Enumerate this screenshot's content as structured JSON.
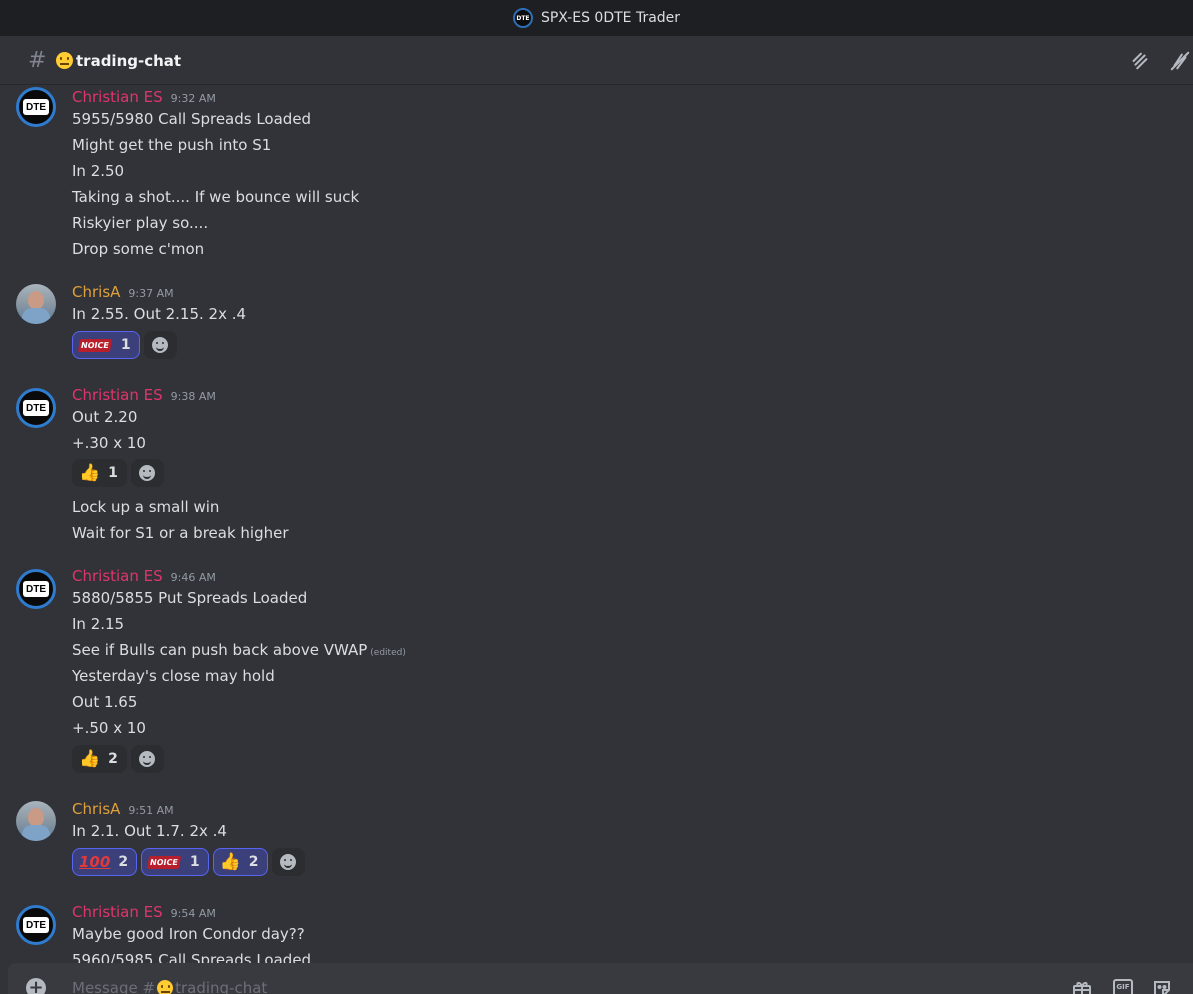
{
  "window": {
    "title": "SPX-ES 0DTE Trader"
  },
  "channel": {
    "hash": "#",
    "name": "trading-chat"
  },
  "messages": [
    {
      "author": "Christian ES",
      "time": "9:32 AM",
      "lines": [
        "5955/5980 Call Spreads Loaded",
        "Might get the push into S1",
        "In 2.50",
        "Taking a shot.... If we bounce will suck",
        "Riskyier play so....",
        "Drop some c'mon"
      ]
    },
    {
      "author": "ChrisA",
      "time": "9:37 AM",
      "lines": [
        "In 2.55. Out 2.15.  2x .4"
      ],
      "reactions": [
        {
          "emoji": "noice",
          "label": "NOICE",
          "count": "1"
        }
      ]
    },
    {
      "author": "Christian ES",
      "time": "9:38 AM",
      "lines": [
        "Out 2.20",
        "+.30 x 10"
      ],
      "reactions": [
        {
          "emoji": "thumbs-up",
          "glyph": "👍",
          "count": "1"
        }
      ],
      "lines_after": [
        "Lock up a small win",
        "Wait for S1 or a break higher"
      ]
    },
    {
      "author": "Christian ES",
      "time": "9:46 AM",
      "lines": [
        "5880/5855 Put Spreads Loaded",
        "In 2.15",
        "See if Bulls can push back above VWAP",
        "Yesterday's close may hold",
        "Out 1.65",
        "+.50 x 10"
      ],
      "edited": "(edited)",
      "reactions": [
        {
          "emoji": "thumbs-up",
          "glyph": "👍",
          "count": "2"
        }
      ]
    },
    {
      "author": "ChrisA",
      "time": "9:51 AM",
      "lines": [
        "In 2.1. Out 1.7. 2x .4"
      ],
      "reactions": [
        {
          "emoji": "hundred",
          "label": "100",
          "count": "2"
        },
        {
          "emoji": "noice",
          "label": "NOICE",
          "count": "1"
        },
        {
          "emoji": "thumbs-up",
          "glyph": "👍",
          "count": "2"
        }
      ]
    },
    {
      "author": "Christian ES",
      "time": "9:54 AM",
      "lines": [
        "Maybe good Iron Condor day??",
        "5960/5985 Call Spreads Loaded"
      ]
    }
  ],
  "avatar_text": "DTE",
  "composer": {
    "placeholder_prefix": "Message #",
    "placeholder_channel": "trading-chat",
    "gif_label": "GIF"
  },
  "colors": {
    "christian": "#e0356b",
    "chrisa": "#e0a03a",
    "accent": "#5865f2",
    "background": "#313338"
  }
}
